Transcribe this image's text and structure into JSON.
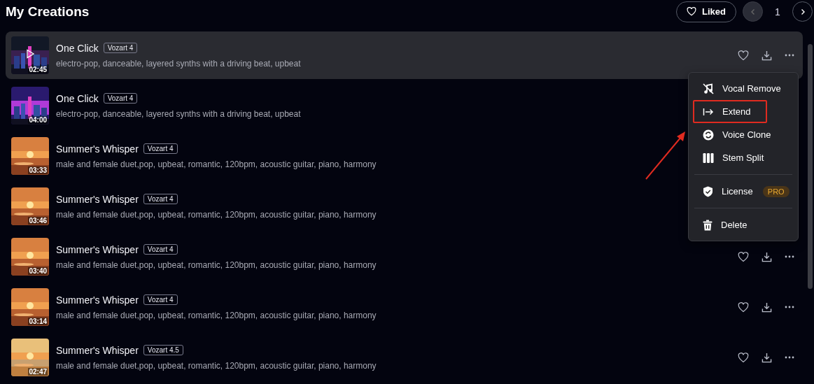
{
  "header": {
    "title": "My Creations",
    "liked_button": "Liked",
    "pagination": {
      "prev_disabled": true,
      "page": "1",
      "next_disabled": false
    }
  },
  "tracks": [
    {
      "title": "One Click",
      "model": "Vozart 4",
      "description": "electro-pop, danceable, layered synths with a driving beat, upbeat",
      "duration": "02:45",
      "selected": true
    },
    {
      "title": "One Click",
      "model": "Vozart 4",
      "description": "electro-pop, danceable, layered synths with a driving beat, upbeat",
      "duration": "04:00",
      "selected": false
    },
    {
      "title": "Summer's Whisper",
      "model": "Vozart 4",
      "description": "male and female duet,pop, upbeat, romantic, 120bpm, acoustic guitar, piano, harmony",
      "duration": "03:33",
      "selected": false
    },
    {
      "title": "Summer's Whisper",
      "model": "Vozart 4",
      "description": "male and female duet,pop, upbeat, romantic, 120bpm, acoustic guitar, piano, harmony",
      "duration": "03:46",
      "selected": false
    },
    {
      "title": "Summer's Whisper",
      "model": "Vozart 4",
      "description": "male and female duet,pop, upbeat, romantic, 120bpm, acoustic guitar, piano, harmony",
      "duration": "03:40",
      "selected": false
    },
    {
      "title": "Summer's Whisper",
      "model": "Vozart 4",
      "description": "male and female duet,pop, upbeat, romantic, 120bpm, acoustic guitar, piano, harmony",
      "duration": "03:14",
      "selected": false
    },
    {
      "title": "Summer's Whisper",
      "model": "Vozart 4.5",
      "description": "male and female duet,pop, upbeat, romantic, 120bpm, acoustic guitar, piano, harmony",
      "duration": "02:47",
      "selected": false
    }
  ],
  "context_menu": {
    "open": true,
    "groups": [
      [
        {
          "label": "Vocal Remove",
          "highlighted": false
        },
        {
          "label": "Extend",
          "highlighted": true
        },
        {
          "label": "Voice Clone",
          "highlighted": false
        },
        {
          "label": "Stem Split",
          "highlighted": false
        }
      ],
      [
        {
          "label": "License",
          "badge": "PRO",
          "highlighted": false
        }
      ],
      [
        {
          "label": "Delete",
          "highlighted": false
        }
      ]
    ]
  },
  "annotation_arrow": true
}
